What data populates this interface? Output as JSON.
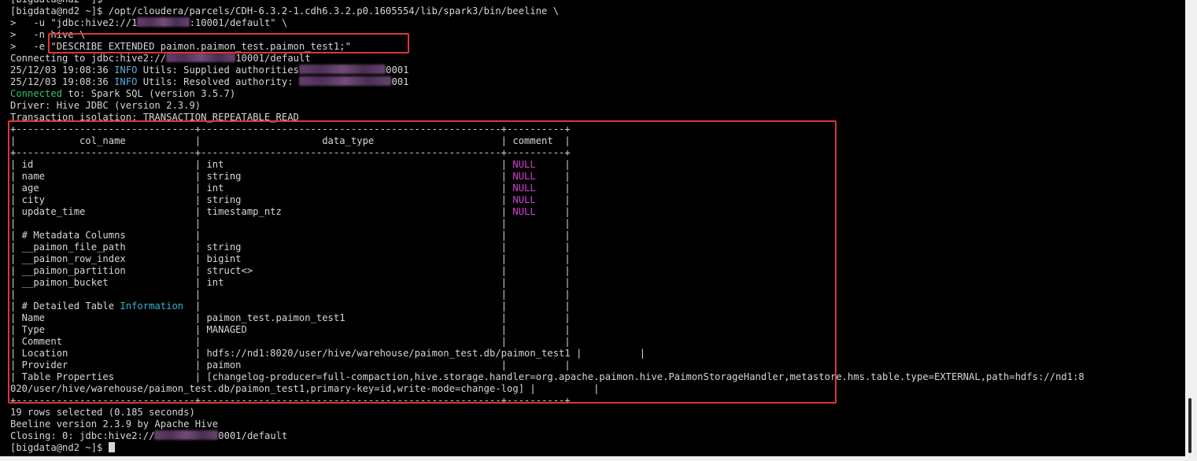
{
  "terminal": {
    "lines": [
      [
        {
          "t": "[bigdata@nd2 ~]$"
        }
      ],
      [
        {
          "t": "[bigdata@nd2 ~]$ /opt/cloudera/parcels/CDH-6.3.2-1.cdh6.3.2.p0.1605554/lib/spark3/bin/beeline \\"
        }
      ],
      [
        {
          "t": ">   -u \"jdbc:hive2://1"
        },
        {
          "blur": 9
        },
        {
          "t": ":10001/default\" \\"
        }
      ],
      [
        {
          "t": ">   -n hive \\"
        }
      ],
      [
        {
          "t": ">   -e \"DESCRIBE EXTENDED paimon.paimon_test.paimon_test1;\""
        }
      ],
      [
        {
          "t": "Connecting to jdbc:hive2://"
        },
        {
          "blur": 12
        },
        {
          "t": "10001/default"
        }
      ],
      [
        {
          "t": "25/12/03 19:08:36 "
        },
        {
          "t": "INFO",
          "c": "info"
        },
        {
          "t": " Utils: Supplied authorities"
        },
        {
          "blur": 15
        },
        {
          "t": "0001"
        }
      ],
      [
        {
          "t": "25/12/03 19:08:36 "
        },
        {
          "t": "INFO",
          "c": "info"
        },
        {
          "t": " Utils: Resolved authority: "
        },
        {
          "blur": 16
        },
        {
          "t": "001"
        }
      ],
      [
        {
          "t": "Connected",
          "c": "ok"
        },
        {
          "t": " to: Spark SQL (version 3.5.7)"
        }
      ],
      [
        {
          "t": "Driver: Hive JDBC (version 2.3.9)"
        }
      ],
      [
        {
          "t": "Transaction isolation: TRANSACTION_REPEATABLE_READ"
        }
      ],
      [
        {
          "t": "+-------------------------------+----------------------------------------------------+----------+"
        }
      ],
      [
        {
          "t": "|           col_name            |                     data_type                      | comment  |"
        }
      ],
      [
        {
          "t": "+-------------------------------+----------------------------------------------------+----------+"
        }
      ],
      [
        {
          "t": "| id                            | int                                                | "
        },
        {
          "t": "NULL",
          "c": "null"
        },
        {
          "t": "     |"
        }
      ],
      [
        {
          "t": "| name                          | string                                             | "
        },
        {
          "t": "NULL",
          "c": "null"
        },
        {
          "t": "     |"
        }
      ],
      [
        {
          "t": "| age                           | int                                                | "
        },
        {
          "t": "NULL",
          "c": "null"
        },
        {
          "t": "     |"
        }
      ],
      [
        {
          "t": "| city                          | string                                             | "
        },
        {
          "t": "NULL",
          "c": "null"
        },
        {
          "t": "     |"
        }
      ],
      [
        {
          "t": "| update_time                   | timestamp_ntz                                      | "
        },
        {
          "t": "NULL",
          "c": "null"
        },
        {
          "t": "     |"
        }
      ],
      [
        {
          "t": "|                               |                                                    |          |"
        }
      ],
      [
        {
          "t": "| # Metadata Columns            |                                                    |          |"
        }
      ],
      [
        {
          "t": "| __paimon_file_path            | string                                             |          |"
        }
      ],
      [
        {
          "t": "| __paimon_row_index            | bigint                                             |          |"
        }
      ],
      [
        {
          "t": "| __paimon_partition            | struct<>                                           |          |"
        }
      ],
      [
        {
          "t": "| __paimon_bucket               | int                                                |          |"
        }
      ],
      [
        {
          "t": "|                               |                                                    |          |"
        }
      ],
      [
        {
          "t": "| # Detailed Table "
        },
        {
          "t": "Information",
          "c": "kw"
        },
        {
          "t": "  |                                                    |          |"
        }
      ],
      [
        {
          "t": "| Name                          | paimon_test.paimon_test1                           |          |"
        }
      ],
      [
        {
          "t": "| Type                          | MANAGED                                            |          |"
        }
      ],
      [
        {
          "t": "| Comment                       |                                                    |          |"
        }
      ],
      [
        {
          "t": "| Location                      | hdfs://nd1:8020/user/hive/warehouse/paimon_test.db/paimon_test1 |          |"
        }
      ],
      [
        {
          "t": "| Provider                      | paimon                                             |          |"
        }
      ],
      [
        {
          "t": "| Table Properties              | [changelog-producer=full-compaction,hive.storage.handler=org.apache.paimon.hive.PaimonStorageHandler,metastore.hms.table.type=EXTERNAL,path=hdfs://nd1:8"
        }
      ],
      [
        {
          "t": "020/user/hive/warehouse/paimon_test.db/paimon_test1,primary-key=id,write-mode=change-log] |          |"
        }
      ],
      [
        {
          "t": "+-------------------------------+----------------------------------------------------+----------+"
        }
      ],
      [
        {
          "t": "19 rows selected (0.185 seconds)"
        }
      ],
      [
        {
          "t": "Beeline version 2.3.9 by Apache Hive"
        }
      ],
      [
        {
          "t": "Closing: 0: jdbc:hive2://"
        },
        {
          "blur": 11
        },
        {
          "t": "0001/default"
        }
      ],
      [
        {
          "t": "[bigdata@nd2 ~]$ "
        },
        {
          "cursor": true
        }
      ]
    ]
  },
  "colors": {
    "background": "#000000",
    "text": "#d6d6d6",
    "info": "#5aa9d6",
    "connected": "#2fc46a",
    "null": "#d23fd2",
    "highlight": "#e03535"
  }
}
